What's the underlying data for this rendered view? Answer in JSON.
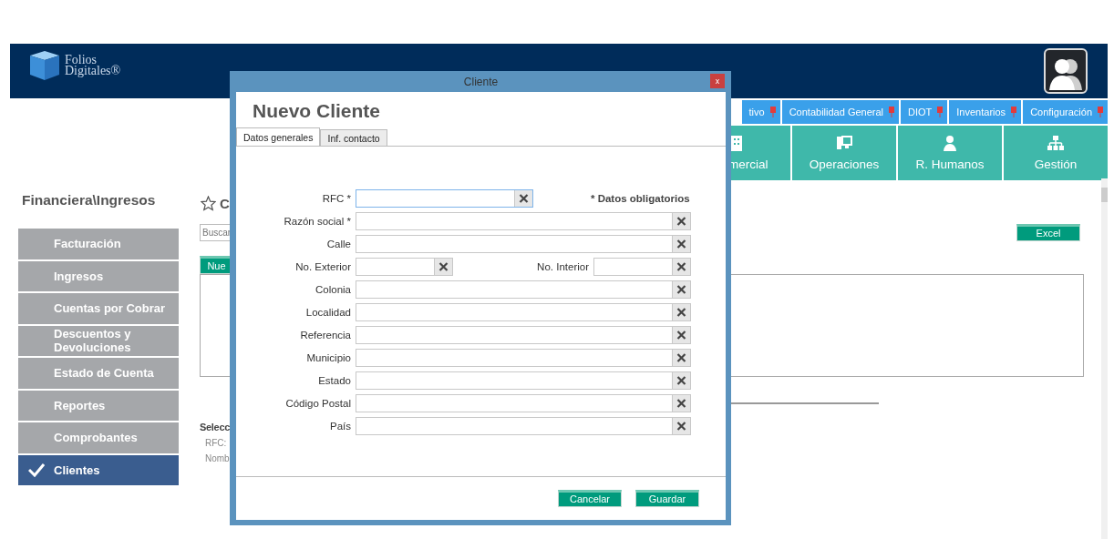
{
  "header": {
    "logo_lines": [
      "Folios",
      "Digitales®"
    ]
  },
  "module_tabs": [
    {
      "label": "tivo"
    },
    {
      "label": "Contabilidad General"
    },
    {
      "label": "DIOT"
    },
    {
      "label": "Inventarios"
    },
    {
      "label": "Configuración"
    }
  ],
  "areas": [
    {
      "label": "mercial",
      "kind": "building"
    },
    {
      "label": "Operaciones",
      "kind": "computer"
    },
    {
      "label": "R. Humanos",
      "kind": "person"
    },
    {
      "label": "Gestión",
      "kind": "org"
    }
  ],
  "breadcrumb": "Financiera\\Ingresos",
  "sidebar": {
    "items": [
      {
        "label": "Facturación",
        "selected": false
      },
      {
        "label": "Ingresos",
        "selected": false
      },
      {
        "label": "Cuentas por Cobrar",
        "selected": false
      },
      {
        "label": "Descuentos y Devoluciones",
        "selected": false
      },
      {
        "label": "Estado de Cuenta",
        "selected": false
      },
      {
        "label": "Reportes",
        "selected": false
      },
      {
        "label": "Comprobantes",
        "selected": false
      },
      {
        "label": "Clientes",
        "selected": true
      }
    ]
  },
  "content": {
    "title": "C",
    "search": {
      "placeholder": "Buscar"
    },
    "new_button": "Nue",
    "excel_button": "Excel",
    "selection_title": "Selecc",
    "selection_fields": [
      "RFC:",
      "Nomb"
    ]
  },
  "dialog": {
    "title": "Cliente",
    "close": "x",
    "heading": "Nuevo Cliente",
    "tabs": [
      {
        "label": "Datos generales",
        "selected": true
      },
      {
        "label": "Inf. contacto",
        "selected": false
      }
    ],
    "rows": [
      {
        "kind": "short",
        "note": "* Datos obligatorios",
        "fields": [
          {
            "label": "RFC *",
            "focused": true
          }
        ]
      },
      {
        "kind": "full",
        "fields": [
          {
            "label": "Razón social *",
            "focused": false
          }
        ]
      },
      {
        "kind": "full",
        "fields": [
          {
            "label": "Calle",
            "focused": false
          }
        ]
      },
      {
        "kind": "pair",
        "fields": [
          {
            "label": "No. Exterior",
            "focused": false
          },
          {
            "label": "No. Interior",
            "focused": false
          }
        ]
      },
      {
        "kind": "full",
        "fields": [
          {
            "label": "Colonia",
            "focused": false
          }
        ]
      },
      {
        "kind": "full",
        "fields": [
          {
            "label": "Localidad",
            "focused": false
          }
        ]
      },
      {
        "kind": "full",
        "fields": [
          {
            "label": "Referencia",
            "focused": false
          }
        ]
      },
      {
        "kind": "full",
        "fields": [
          {
            "label": "Municipio",
            "focused": false
          }
        ]
      },
      {
        "kind": "full",
        "fields": [
          {
            "label": "Estado",
            "focused": false
          }
        ]
      },
      {
        "kind": "full",
        "fields": [
          {
            "label": "Código Postal",
            "focused": false
          }
        ]
      },
      {
        "kind": "full",
        "fields": [
          {
            "label": "País",
            "focused": false
          }
        ]
      }
    ],
    "buttons": [
      "Cancelar",
      "Guardar"
    ]
  }
}
